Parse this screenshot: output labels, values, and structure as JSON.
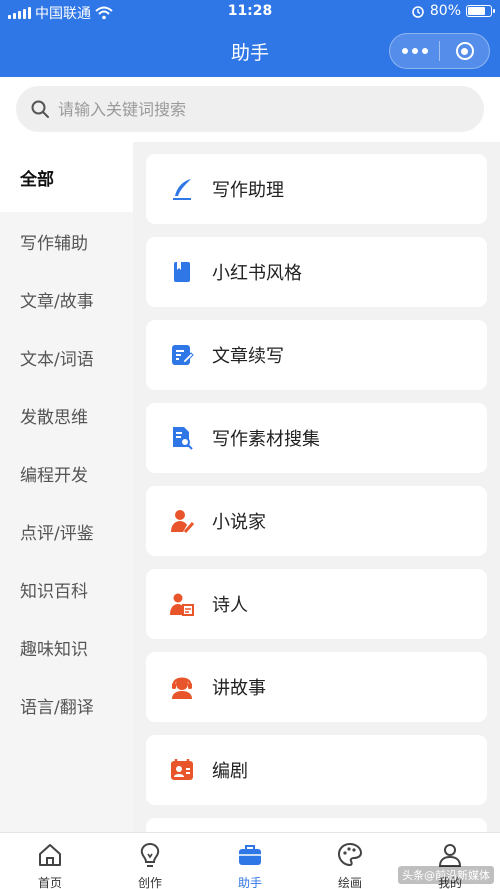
{
  "status_bar": {
    "carrier": "中国联通",
    "time": "11:28",
    "battery": "80%",
    "battery_level": 0.8
  },
  "nav": {
    "title": "助手"
  },
  "search": {
    "placeholder": "请输入关键词搜索"
  },
  "sidebar": {
    "items": [
      {
        "label": "全部",
        "active": true
      },
      {
        "label": "写作辅助"
      },
      {
        "label": "文章/故事"
      },
      {
        "label": "文本/词语"
      },
      {
        "label": "发散思维"
      },
      {
        "label": "编程开发"
      },
      {
        "label": "点评/评鉴"
      },
      {
        "label": "知识百科"
      },
      {
        "label": "趣味知识"
      },
      {
        "label": "语言/翻译"
      }
    ]
  },
  "cards": [
    {
      "label": "写作助理",
      "icon": "quill-icon",
      "color": "#2f76e6"
    },
    {
      "label": "小红书风格",
      "icon": "book-icon",
      "color": "#2f76e6"
    },
    {
      "label": "文章续写",
      "icon": "edit-doc-icon",
      "color": "#2f76e6"
    },
    {
      "label": "写作素材搜集",
      "icon": "doc-search-icon",
      "color": "#2f76e6"
    },
    {
      "label": "小说家",
      "icon": "writer-person-icon",
      "color": "#e8552a"
    },
    {
      "label": "诗人",
      "icon": "poet-person-icon",
      "color": "#e8552a"
    },
    {
      "label": "讲故事",
      "icon": "headset-person-icon",
      "color": "#e8552a"
    },
    {
      "label": "编剧",
      "icon": "script-icon",
      "color": "#e8552a"
    }
  ],
  "tabbar": {
    "items": [
      {
        "label": "首页",
        "icon": "home-icon"
      },
      {
        "label": "创作",
        "icon": "bulb-icon"
      },
      {
        "label": "助手",
        "icon": "briefcase-icon",
        "active": true
      },
      {
        "label": "绘画",
        "icon": "palette-icon"
      },
      {
        "label": "我的",
        "icon": "profile-icon"
      }
    ]
  },
  "watermark": "头条@前沿新媒体"
}
